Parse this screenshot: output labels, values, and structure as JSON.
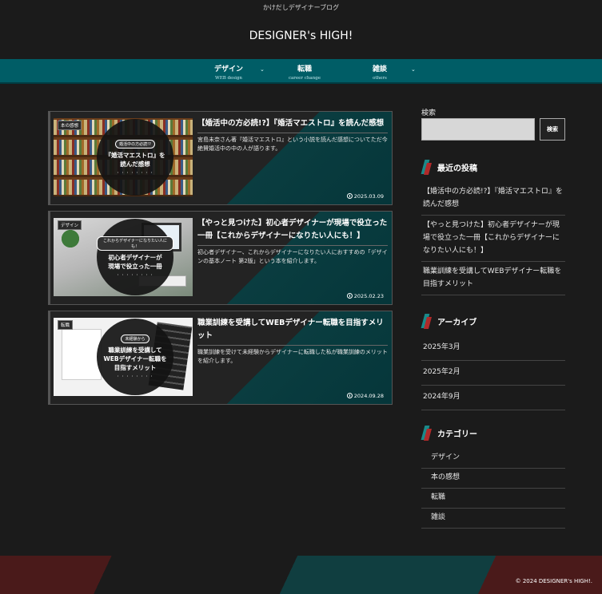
{
  "header": {
    "tagline": "かけだしデザイナーブログ",
    "site_title": "DESIGNER's HIGH!"
  },
  "nav": {
    "items": [
      {
        "label": "デザイン",
        "sub": "WEB design",
        "has_dropdown": true
      },
      {
        "label": "転職",
        "sub": "career change",
        "has_dropdown": false
      },
      {
        "label": "雑談",
        "sub": "others",
        "has_dropdown": true
      }
    ]
  },
  "posts": [
    {
      "category": "本の感想",
      "thumb_badge": "婚活中の方必読!?",
      "thumb_title_1": "『婚活マエストロ』を",
      "thumb_title_2": "読んだ感想",
      "title": "【婚活中の方必読!?】『婚活マエストロ』を読んだ感想",
      "excerpt": "宮島未奈さん著『婚活マエストロ』という小説を読んだ感想についてただ今絶賛婚活中の中の人が語ります。",
      "date": "2025.03.09"
    },
    {
      "category": "デザイン",
      "thumb_badge": "これからデザイナーになりたい人にも！",
      "thumb_title_1": "初心者デザイナーが",
      "thumb_title_2": "現場で役立った一冊",
      "title": "【やっと見つけた】初心者デザイナーが現場で役立った一冊【これからデザイナーになりたい人にも！】",
      "excerpt": "初心者デザイナー、これからデザイナーになりたい人におすすめの「デザインの基本ノート 第2版」という本を紹介します。",
      "date": "2025.02.23"
    },
    {
      "category": "転職",
      "thumb_badge": "未経験から",
      "thumb_title_1": "職業訓練を受講して",
      "thumb_title_2": "WEBデザイナー転職を",
      "thumb_title_3": "目指すメリット",
      "title": "職業訓練を受講してWEBデザイナー転職を目指すメリット",
      "excerpt": "職業訓練を受けて未経験からデザイナーに転職した私が職業訓練のメリットを紹介します。",
      "date": "2024.09.28"
    }
  ],
  "sidebar": {
    "search": {
      "label": "検索",
      "placeholder": "",
      "button": "検索"
    },
    "recent_title": "最近の投稿",
    "recent": [
      "【婚活中の方必読!?】『婚活マエストロ』を読んだ感想",
      "【やっと見つけた】初心者デザイナーが現場で役立った一冊【これからデザイナーになりたい人にも！】",
      "職業訓練を受講してWEBデザイナー転職を目指すメリット"
    ],
    "archive_title": "アーカイブ",
    "archives": [
      "2025年3月",
      "2025年2月",
      "2024年9月"
    ],
    "category_title": "カテゴリー",
    "categories": [
      "デザイン",
      "本の感想",
      "転職",
      "雑談"
    ]
  },
  "footer": {
    "copyright": "© 2024 DESIGNER's HIGH!."
  },
  "colors": {
    "background": "#1b1b1b",
    "nav": "#005d66",
    "accent_teal": "#1a8a8a",
    "accent_red": "#b02a2a"
  }
}
